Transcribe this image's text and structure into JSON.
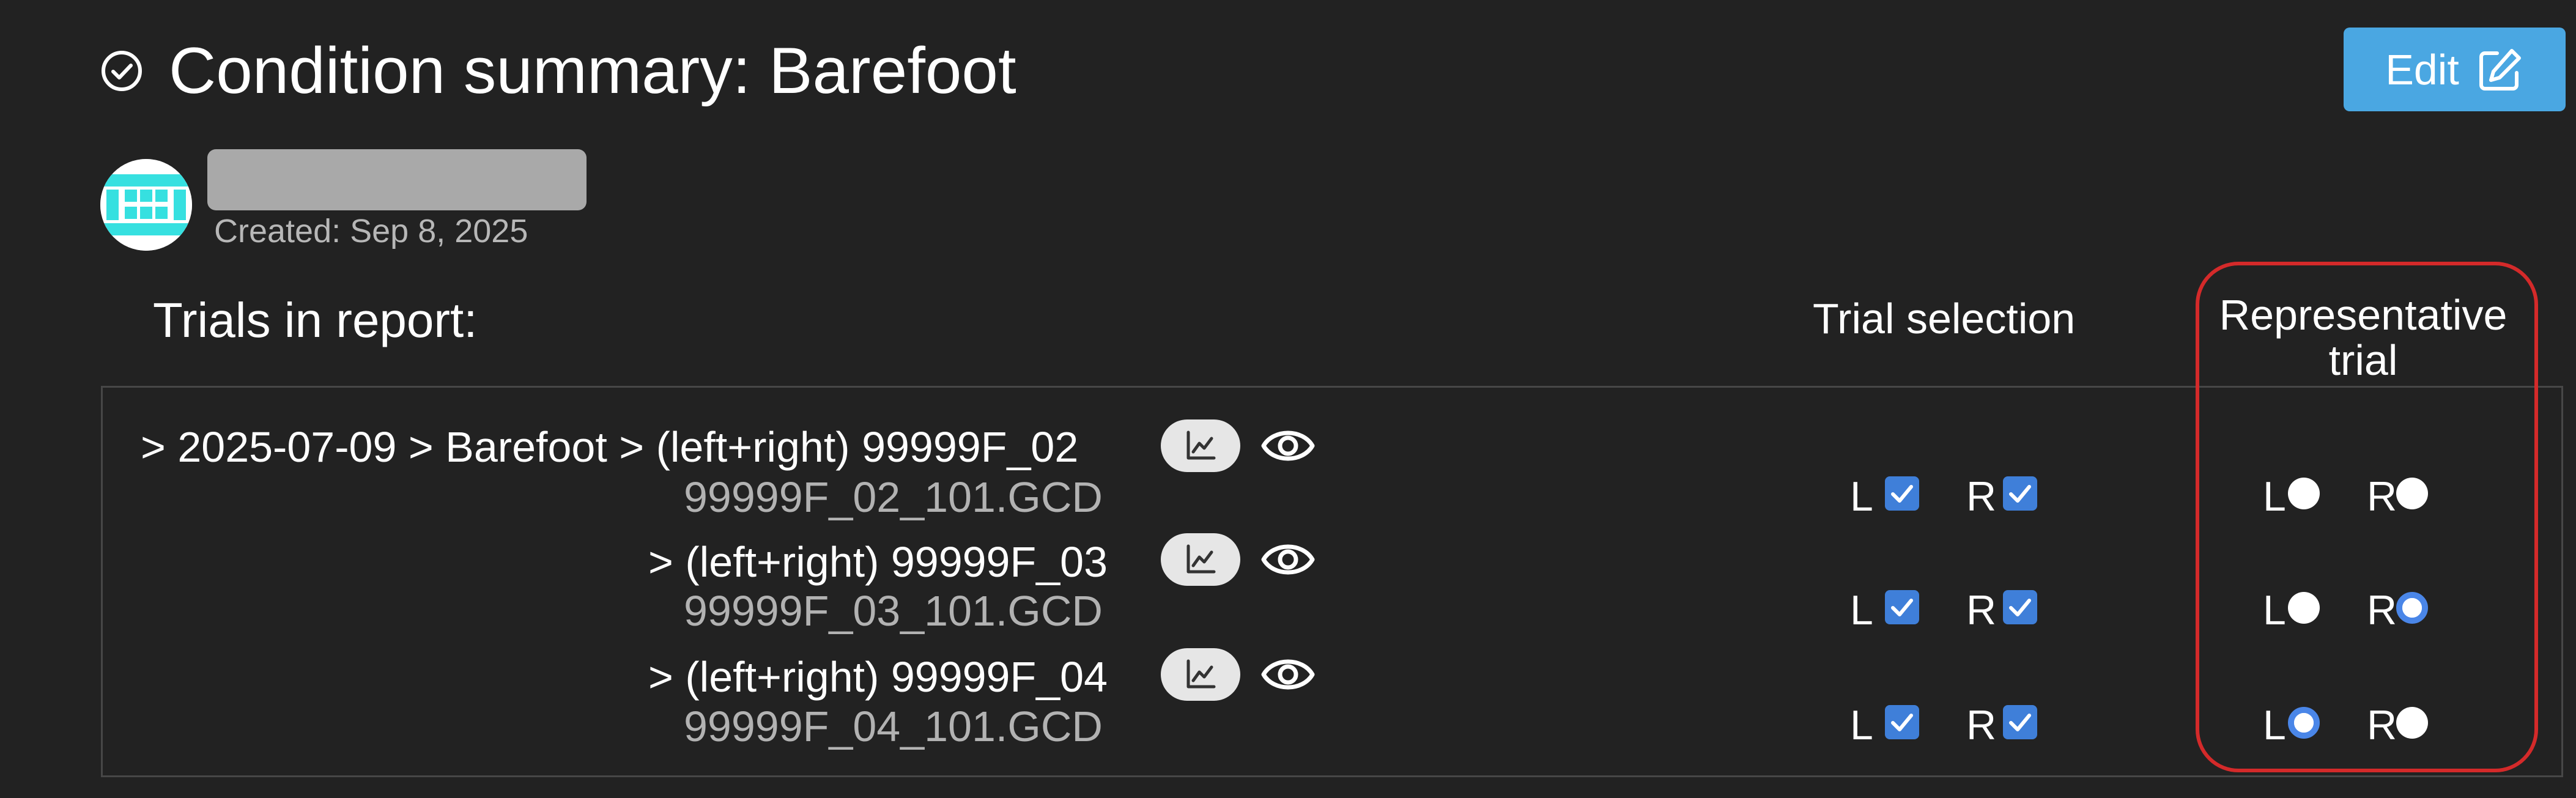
{
  "header": {
    "title": "Condition summary: Barefoot",
    "title_icon": "check-circle-icon",
    "edit_label": "Edit",
    "edit_icon": "edit-square-icon"
  },
  "user": {
    "name": "",
    "created": "Created: Sep 8, 2025"
  },
  "columns": {
    "trials_heading": "Trials in report:",
    "trial_selection": "Trial selection",
    "representative_trial": "Representative trial"
  },
  "trials": [
    {
      "path": "> 2025-07-09 > Barefoot > (left+right) 99999F_02",
      "file": "99999F_02_101.GCD",
      "selection": {
        "left_label": "L",
        "left_checked": true,
        "right_label": "R",
        "right_checked": true
      },
      "representative": {
        "left_label": "L",
        "left_selected": false,
        "right_label": "R",
        "right_selected": false
      }
    },
    {
      "path": "> (left+right) 99999F_03",
      "file": "99999F_03_101.GCD",
      "selection": {
        "left_label": "L",
        "left_checked": true,
        "right_label": "R",
        "right_checked": true
      },
      "representative": {
        "left_label": "L",
        "left_selected": false,
        "right_label": "R",
        "right_selected": true
      }
    },
    {
      "path": "> (left+right) 99999F_04",
      "file": "99999F_04_101.GCD",
      "selection": {
        "left_label": "L",
        "left_checked": true,
        "right_label": "R",
        "right_checked": true
      },
      "representative": {
        "left_label": "L",
        "left_selected": true,
        "right_label": "R",
        "right_selected": false
      }
    }
  ],
  "colors": {
    "background": "#222222",
    "accent": "#4aa7e2",
    "checkbox": "#3f7fd9",
    "radio_selected": "#4a86e8",
    "highlight": "#d42a2a",
    "muted_text": "#b2b2b2"
  }
}
